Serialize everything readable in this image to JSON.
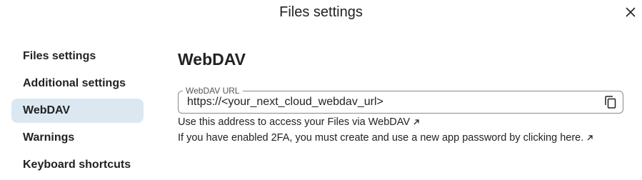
{
  "dialog": {
    "title": "Files settings",
    "close_icon": "close-icon"
  },
  "sidebar": {
    "items": [
      {
        "label": "Files settings",
        "active": false
      },
      {
        "label": "Additional settings",
        "active": false
      },
      {
        "label": "WebDAV",
        "active": true
      },
      {
        "label": "Warnings",
        "active": false
      },
      {
        "label": "Keyboard shortcuts",
        "active": false
      }
    ]
  },
  "main": {
    "section_title": "WebDAV",
    "webdav_field": {
      "label": "WebDAV URL",
      "value": "https://<your_next_cloud_webdav_url>",
      "copy_icon": "copy-icon"
    },
    "help": {
      "access_text": "Use this address to access your Files via WebDAV",
      "twofa_text": "If you have enabled 2FA, you must create and use a new app password by clicking here.",
      "external_icon": "external-link-icon"
    }
  },
  "colors": {
    "active_item_bg": "#dbe8f1",
    "text": "#222222",
    "border": "#8a8a8a"
  }
}
